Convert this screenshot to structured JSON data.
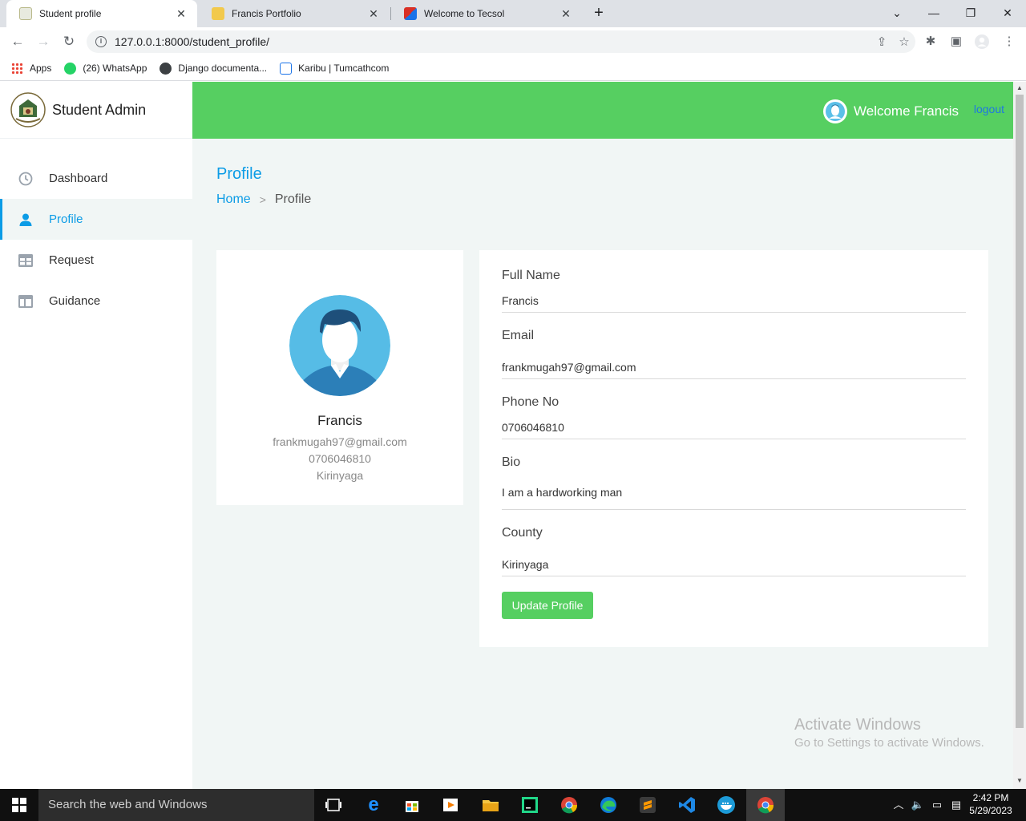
{
  "browser": {
    "tabs": [
      {
        "title": "Student profile",
        "active": true
      },
      {
        "title": "Francis Portfolio",
        "active": false
      },
      {
        "title": "Welcome to Tecsol",
        "active": false
      }
    ],
    "new_tab": "+",
    "url": "127.0.0.1:8000/student_profile/",
    "bookmarks": [
      {
        "label": "Apps"
      },
      {
        "label": "(26) WhatsApp"
      },
      {
        "label": "Django documenta..."
      },
      {
        "label": "Karibu | Tumcathcom"
      }
    ]
  },
  "app": {
    "brand": "Student Admin",
    "menu": [
      {
        "label": "Dashboard",
        "icon": "clock-icon"
      },
      {
        "label": "Profile",
        "icon": "user-icon"
      },
      {
        "label": "Request",
        "icon": "table-icon"
      },
      {
        "label": "Guidance",
        "icon": "columns-icon"
      }
    ],
    "header": {
      "welcome": "Welcome Francis",
      "logout": "logout"
    },
    "page_title": "Profile",
    "breadcrumb": {
      "home": "Home",
      "separator": ">",
      "current": "Profile"
    },
    "profile_card": {
      "name": "Francis",
      "email": "frankmugah97@gmail.com",
      "phone": "0706046810",
      "county": "Kirinyaga"
    },
    "form": {
      "full_name_label": "Full Name",
      "full_name": "Francis",
      "email_label": "Email",
      "email": "frankmugah97@gmail.com",
      "phone_label": "Phone No",
      "phone": "0706046810",
      "bio_label": "Bio",
      "bio": "I am a hardworking man",
      "county_label": "County",
      "county": "Kirinyaga",
      "submit": "Update Profile"
    },
    "colors": {
      "accent_green": "#56cf61",
      "accent_blue": "#0c9ce6"
    }
  },
  "watermark": {
    "line1": "Activate Windows",
    "line2": "Go to Settings to activate Windows."
  },
  "taskbar": {
    "search_placeholder": "Search the web and Windows",
    "time": "2:42 PM",
    "date": "5/29/2023"
  }
}
